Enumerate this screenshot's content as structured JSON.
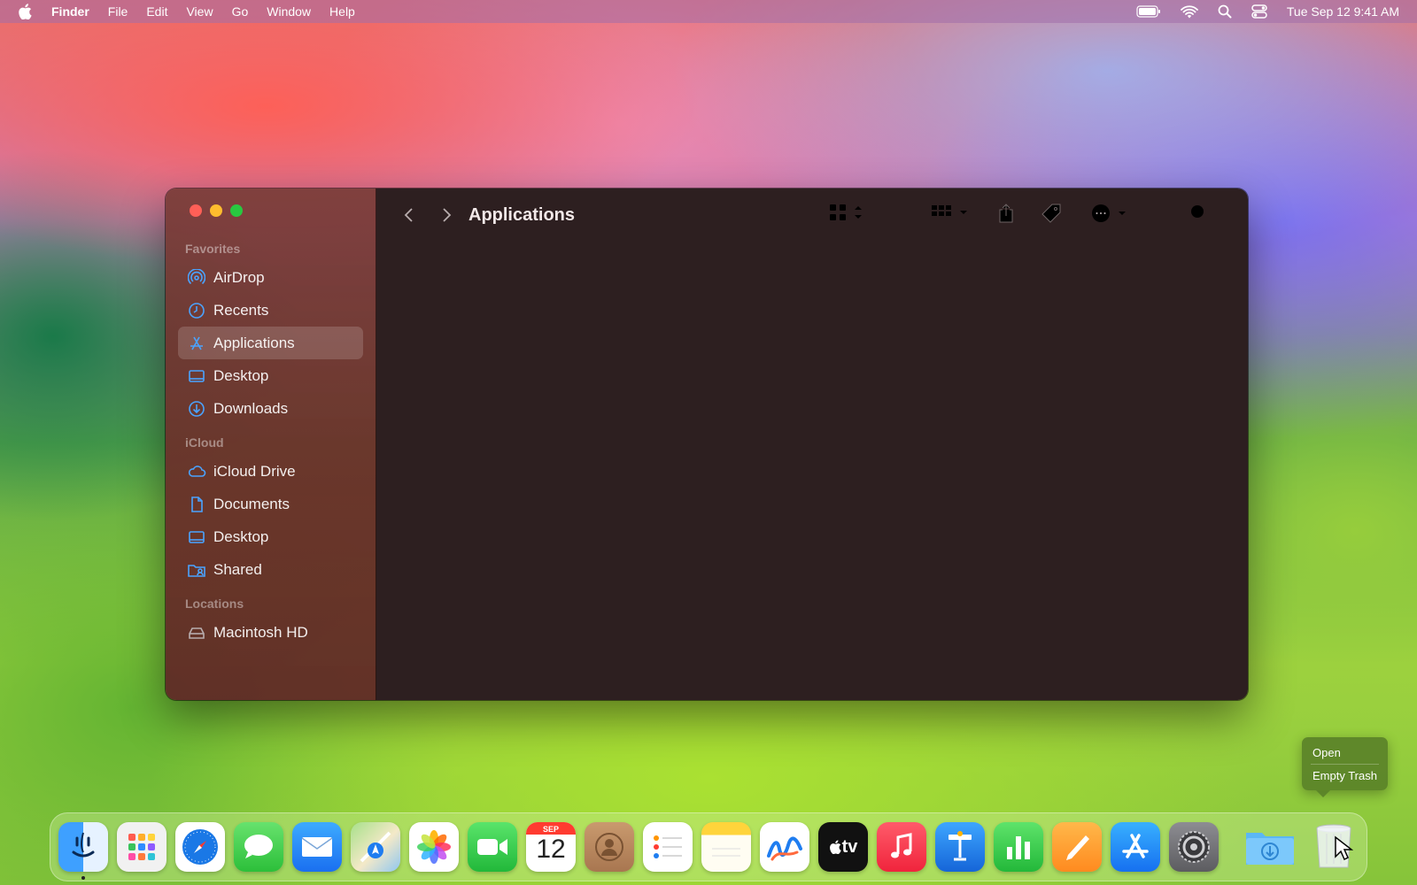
{
  "menubar": {
    "app_name": "Finder",
    "items": [
      "File",
      "Edit",
      "View",
      "Go",
      "Window",
      "Help"
    ],
    "datetime": "Tue Sep 12  9:41 AM"
  },
  "window": {
    "title": "Applications",
    "sidebar": {
      "favorites_title": "Favorites",
      "favorites": [
        "AirDrop",
        "Recents",
        "Applications",
        "Desktop",
        "Downloads"
      ],
      "icloud_title": "iCloud",
      "icloud": [
        "iCloud Drive",
        "Documents",
        "Desktop",
        "Shared"
      ],
      "locations_title": "Locations",
      "locations": [
        "Macintosh HD"
      ],
      "selected": "Applications"
    }
  },
  "context_menu": {
    "items": [
      "Open",
      "Empty Trash"
    ]
  },
  "dock": {
    "calendar_month": "SEP",
    "calendar_day": "12",
    "tv_label": "tv",
    "apps": [
      "Finder",
      "Launchpad",
      "Safari",
      "Messages",
      "Mail",
      "Maps",
      "Photos",
      "FaceTime",
      "Calendar",
      "Contacts",
      "Reminders",
      "Notes",
      "Freeform",
      "TV",
      "Music",
      "Keynote",
      "Numbers",
      "Pages",
      "App Store",
      "System Settings",
      "Downloads",
      "Trash"
    ]
  },
  "colors": {
    "accent": "#4aa3ff",
    "close": "#ff5f57",
    "minimize": "#febc2e",
    "zoom": "#28c840"
  }
}
